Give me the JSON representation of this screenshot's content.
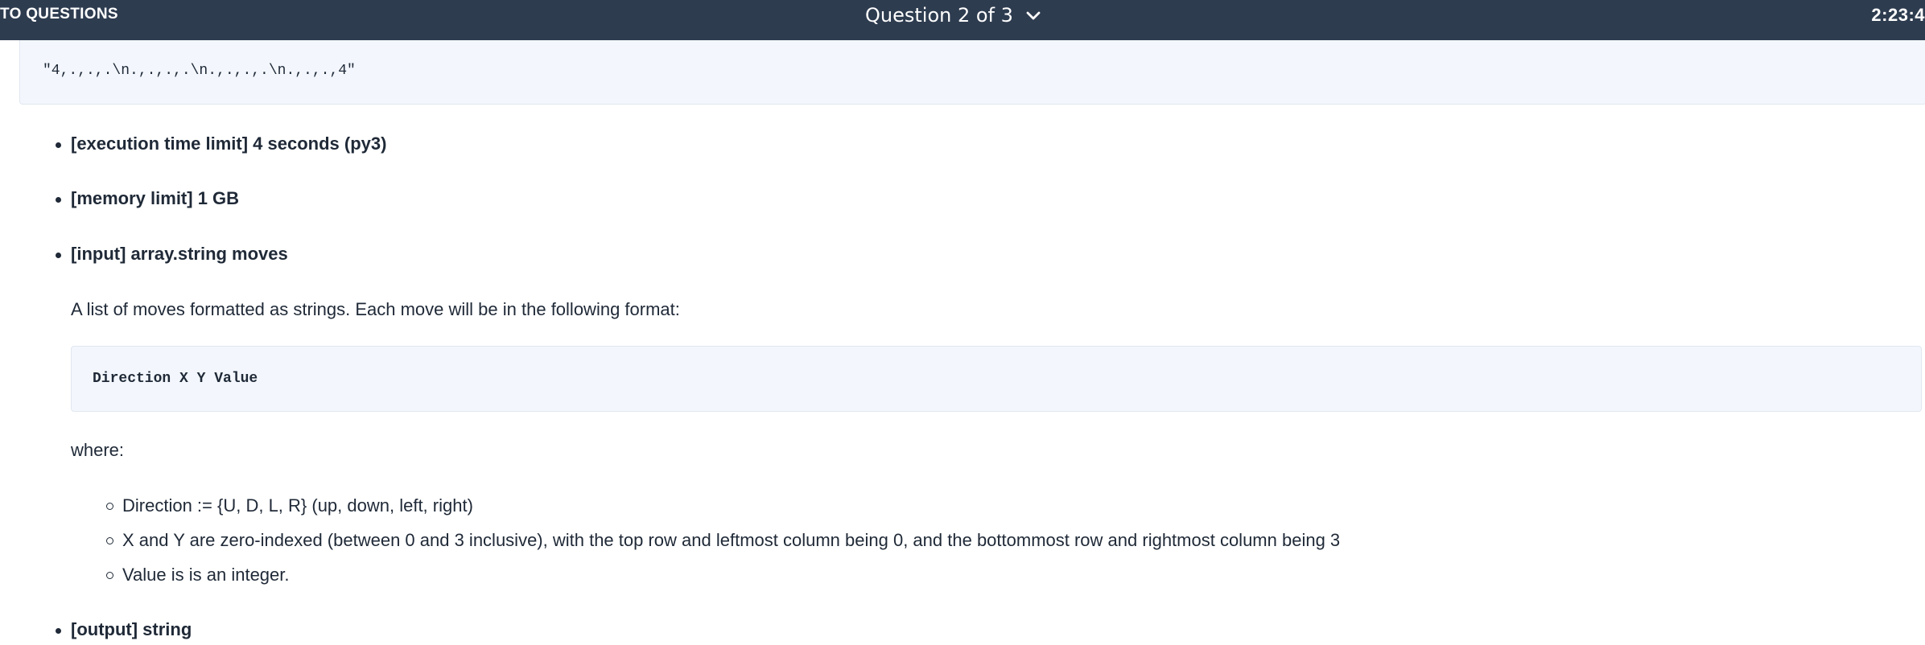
{
  "header": {
    "back_label": "TO QUESTIONS",
    "question_label": "Question 2 of 3",
    "timer": "2:23:4"
  },
  "example_output": "\"4,.,.,.\\n.,.,.,.\\n.,.,.,.\\n.,.,.,4\"",
  "specs": {
    "time_limit": "[execution time limit] 4 seconds (py3)",
    "memory_limit": "[memory limit] 1 GB",
    "input_label": "[input] array.string moves",
    "input_description": "A list of moves formatted as strings. Each move will be in the following format:",
    "move_format": "Direction X Y Value",
    "where_label": "where:",
    "where_items": [
      "Direction := {U, D, L, R} (up, down, left, right)",
      "X and Y are zero-indexed (between 0 and 3 inclusive), with the top row and leftmost column being 0, and the bottommost row and rightmost column being 3",
      "Value is is an integer."
    ],
    "output_label": "[output] string"
  },
  "colors": {
    "header_bg": "#2e3c50",
    "code_bg": "#f3f7fd",
    "text": "#1f2937"
  }
}
